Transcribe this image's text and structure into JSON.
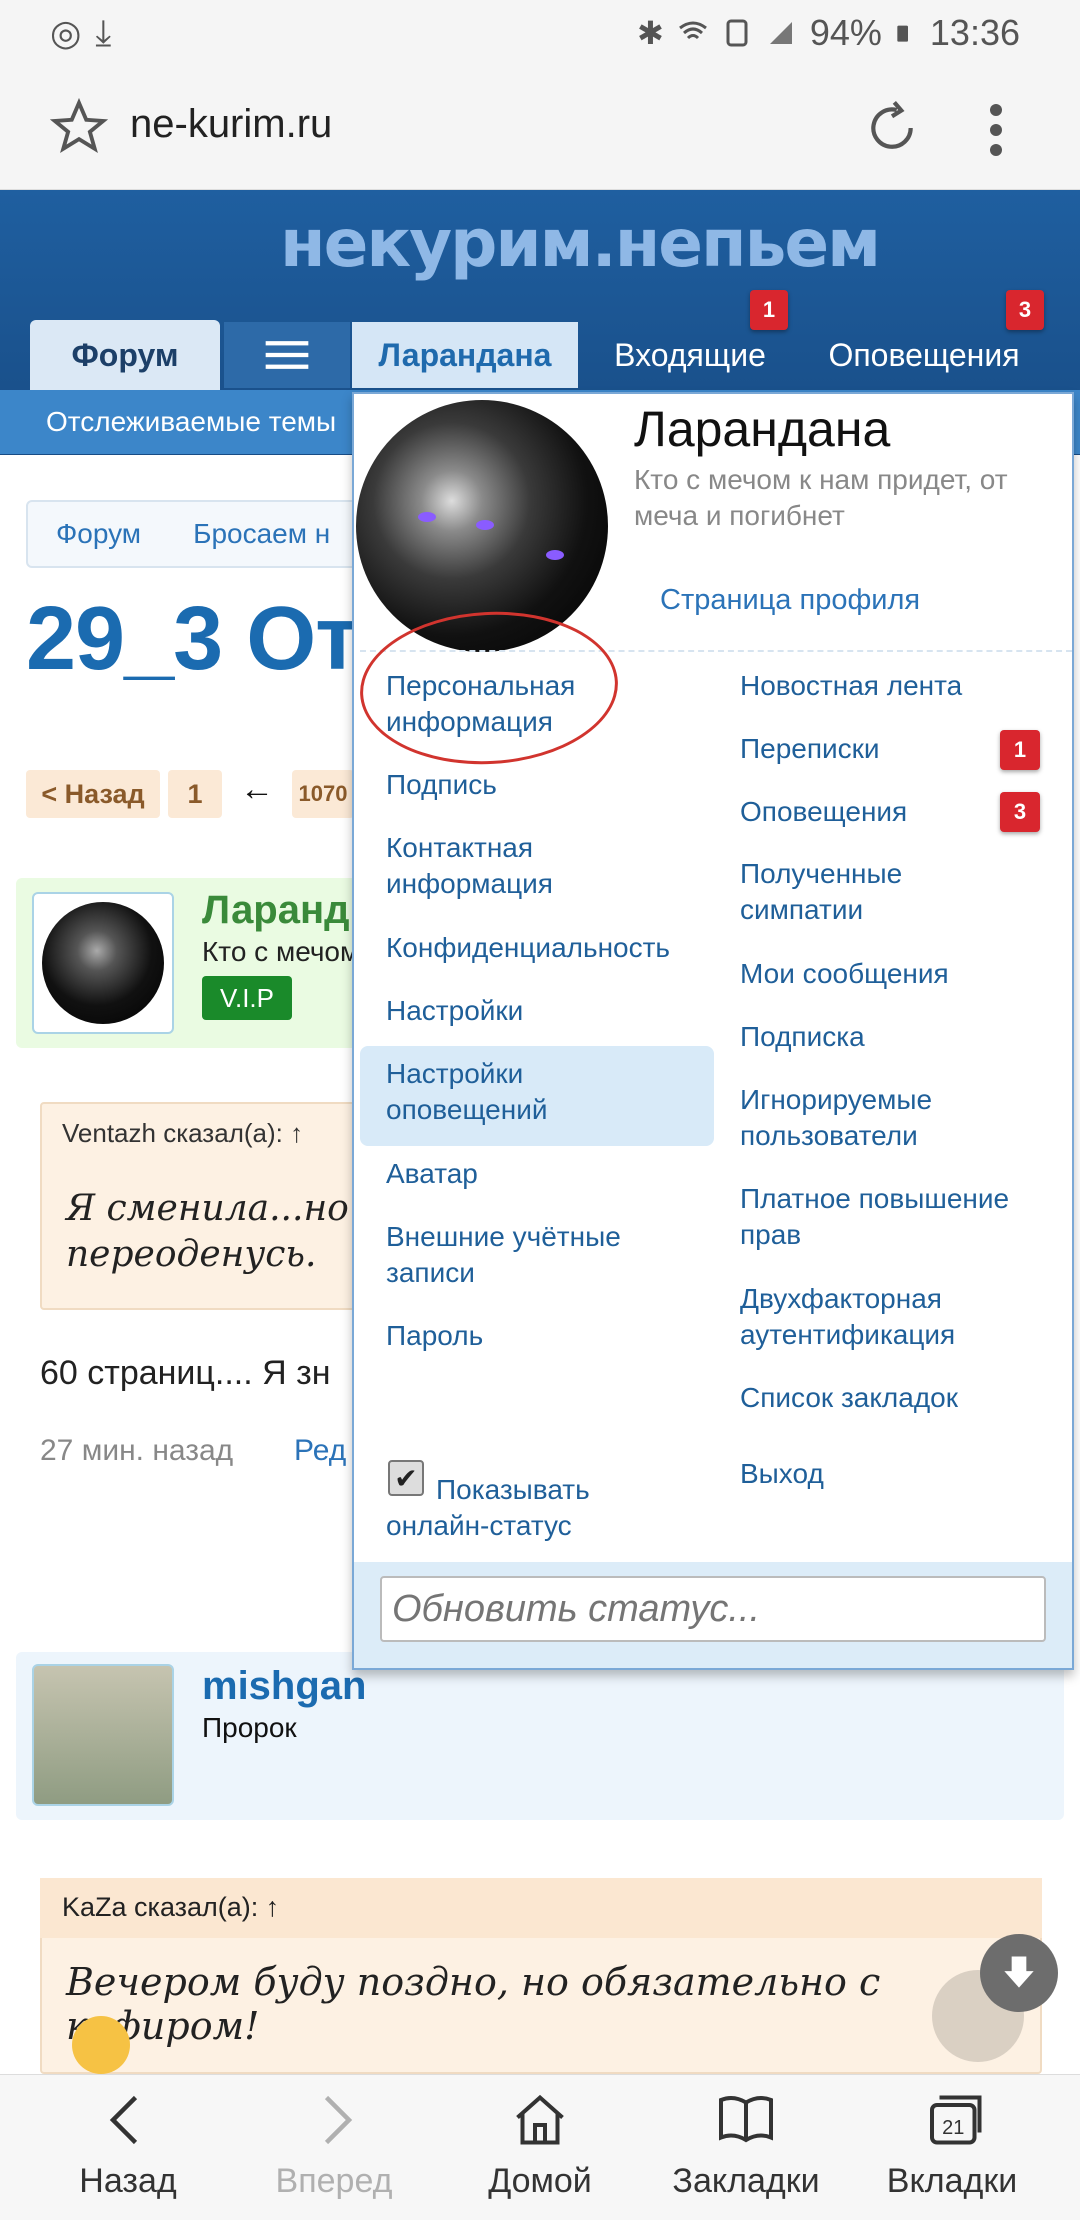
{
  "status_bar": {
    "battery": "94%",
    "time": "13:36",
    "left_icons": [
      "alarm-sync-icon",
      "download-icon"
    ],
    "right_icons": [
      "bluetooth-icon",
      "wifi-icon",
      "sim-icon",
      "signal-icon",
      "battery-icon"
    ]
  },
  "browser": {
    "url": "ne-kurim.ru"
  },
  "site": {
    "logo": "некурим.непьем"
  },
  "nav": {
    "forum": "Форум",
    "user": "Ларандана",
    "inbox": "Входящие",
    "inbox_badge": "1",
    "alerts": "Оповещения",
    "alerts_badge": "3",
    "subnav_link": "Отслеживаемые темы"
  },
  "page": {
    "breadcrumb": [
      "Форум",
      "Бросаем н"
    ],
    "thread_title": "29_3 Отт",
    "pager": {
      "back": "< Назад",
      "page1": "1",
      "arrow": "←",
      "last": "1070"
    },
    "post1": {
      "name": "Ларанд",
      "title": "Кто с мечом",
      "badge": "V.I.P",
      "quote_head": "Ventazh сказал(а): ↑",
      "quote_line1": "Я сменила...но ч",
      "quote_line2": "переоденусь.",
      "body": "60 страниц.... Я зн",
      "time": "27 мин. назад",
      "edit": "Ред"
    },
    "post2": {
      "name": "mishgan",
      "title": "Пророк",
      "quote_head": "KaZa сказал(а): ↑",
      "quote_text": "Вечером буду поздно, но обязательно с кефиром!"
    }
  },
  "user_menu": {
    "username": "Ларандана",
    "status": "Кто с мечом к нам придет, от меча и погибнет",
    "profile_link": "Страница профиля",
    "left_items": [
      "Персональная информация",
      "Подпись",
      "Контактная информация",
      "Конфиденциальность",
      "Настройки",
      "Настройки оповещений",
      "Аватар",
      "Внешние учётные записи",
      "Пароль"
    ],
    "right_items": [
      "Новостная лента",
      "Переписки",
      "Оповещения",
      "Полученные симпатии",
      "Мои сообщения",
      "Подписка",
      "Игнорируемые пользователи",
      "Платное повышение прав",
      "Двухфакторная аутентификация",
      "Список закладок",
      "Выход"
    ],
    "conversations_badge": "1",
    "alerts_badge": "3",
    "online_status_label": "Показывать онлайн-статус",
    "online_status_checked": true,
    "status_placeholder": "Обновить статус..."
  },
  "bottom_bar": {
    "back": "Назад",
    "forward": "Вперед",
    "home": "Домой",
    "bookmarks": "Закладки",
    "tabs": "Вкладки",
    "tabs_count": "21"
  },
  "colors": {
    "header_blue": "#1f5fa0",
    "link_blue": "#1f5f99",
    "badge_red": "#d9262e",
    "annotation_red": "#d1342e",
    "selected_item_bg": "#d8eaf8"
  }
}
